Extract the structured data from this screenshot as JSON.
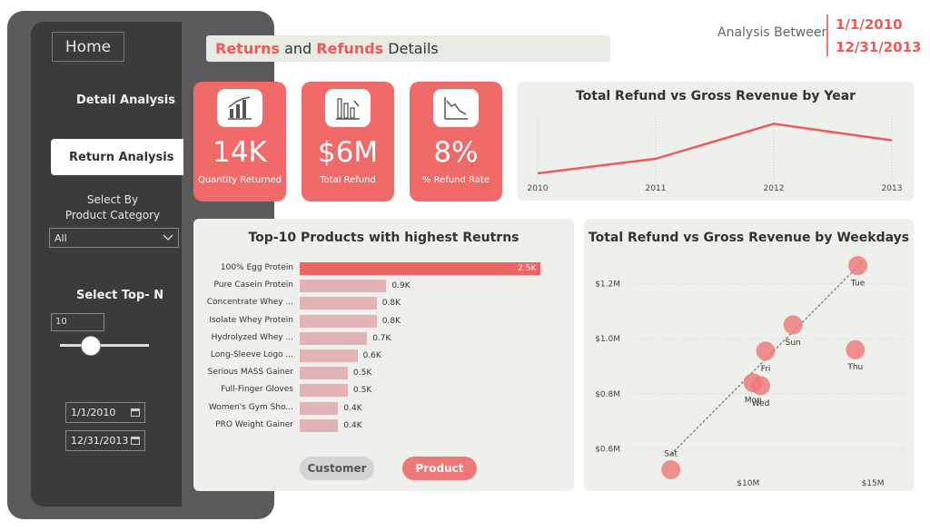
{
  "nav": {
    "home": "Home",
    "detail_analysis": "Detail Analysis",
    "return_analysis": "Return Analysis",
    "select_by_line1": "Select By",
    "select_by_line2": "Product Category",
    "category_value": "All",
    "select_top_n": "Select Top- N",
    "top_n_value": "10",
    "slider_value": 10,
    "start_date": "1/1/2010",
    "end_date": "12/31/2013"
  },
  "header": {
    "title_part1": "Returns",
    "title_and": " and ",
    "title_part2": "Refunds",
    "title_rest": " Details",
    "analysis_label": "Analysis Between",
    "date_from": "1/1/2010",
    "date_to": "12/31/2013"
  },
  "kpis": [
    {
      "value": "14K",
      "label": "Quantity Returned",
      "icon": "bar-chart-icon"
    },
    {
      "value": "$6M",
      "label": "Total Refund",
      "icon": "declining-bars-icon"
    },
    {
      "value": "8%",
      "label": "% Refund Rate",
      "icon": "declining-line-icon"
    }
  ],
  "toggles": {
    "customer": "Customer",
    "product": "Product"
  },
  "colors": {
    "accent": "#f06a6a",
    "bar_primary": "#ee6464",
    "bar_secondary": "#e3b3b6",
    "sidebar": "#3b3b3b"
  },
  "chart_data": [
    {
      "type": "line",
      "title": "Total Refund vs Gross Revenue by Year",
      "x": [
        "2010",
        "2011",
        "2012",
        "2013"
      ],
      "series": [
        {
          "values": [
            0.1,
            0.33,
            0.88,
            0.62
          ]
        }
      ],
      "grid": true
    },
    {
      "type": "bar",
      "title": "Top-10 Products with highest Reutrns",
      "categories": [
        "100% Egg Protein",
        "Pure Casein Protein",
        "Concentrate Whey ...",
        "Isolate Whey Protein",
        "Hydrolyzed Whey ...",
        "Long-Sleeve Logo ...",
        "Serious MASS Gainer",
        "Full-Finger Gloves",
        "Women's Gym Sho...",
        "PRO Weight Gainer"
      ],
      "values": [
        2.5,
        0.9,
        0.8,
        0.8,
        0.7,
        0.6,
        0.5,
        0.5,
        0.4,
        0.4
      ],
      "labels": [
        "2.5K",
        "0.9K",
        "0.8K",
        "0.8K",
        "0.7K",
        "0.6K",
        "0.5K",
        "0.5K",
        "0.4K",
        "0.4K"
      ]
    },
    {
      "type": "scatter",
      "title": "Total Refund vs Gross Revenue by Weekdays",
      "yticks": [
        "$1.2M",
        "$1.0M",
        "$0.8M",
        "$0.6M"
      ],
      "ytick_values": [
        1.2,
        1.0,
        0.8,
        0.6
      ],
      "xticks": [
        "$10M",
        "$15M"
      ],
      "xtick_values": [
        10,
        15
      ],
      "xlim": [
        5.6,
        15.8
      ],
      "ylim": [
        0.52,
        1.27
      ],
      "points": [
        {
          "label": "Tue",
          "x": 14.4,
          "y": 1.265
        },
        {
          "label": "Sun",
          "x": 11.8,
          "y": 1.05
        },
        {
          "label": "Fri",
          "x": 10.7,
          "y": 0.955
        },
        {
          "label": "Thu",
          "x": 14.3,
          "y": 0.96
        },
        {
          "label": "Wed",
          "x": 10.5,
          "y": 0.83
        },
        {
          "label": "Mon",
          "x": 10.2,
          "y": 0.84
        },
        {
          "label": "Sat",
          "x": 6.9,
          "y": 0.525
        }
      ],
      "trendline": {
        "from": [
          6.9,
          0.58
        ],
        "to": [
          14.6,
          1.28
        ]
      }
    }
  ]
}
